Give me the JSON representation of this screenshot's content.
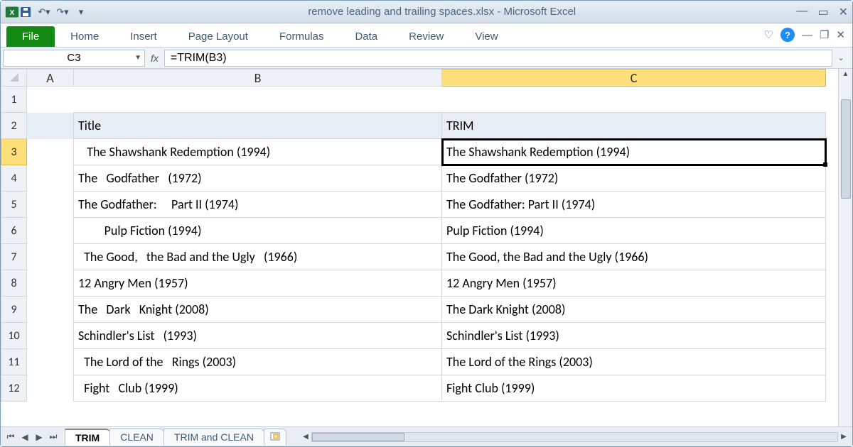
{
  "title": "remove leading and trailing spaces.xlsx  -  Microsoft Excel",
  "ribbon_tabs": [
    "File",
    "Home",
    "Insert",
    "Page Layout",
    "Formulas",
    "Data",
    "Review",
    "View"
  ],
  "namebox": "C3",
  "formula": "=TRIM(B3)",
  "columns": [
    "A",
    "B",
    "C"
  ],
  "headerB": "Title",
  "headerC": "TRIM",
  "rows": [
    {
      "n": 1,
      "b": "",
      "c": ""
    },
    {
      "n": 2,
      "b": "Title",
      "c": "TRIM",
      "hdr": true
    },
    {
      "n": 3,
      "b": "   The Shawshank Redemption (1994)",
      "c": "The Shawshank Redemption (1994)",
      "sel": true
    },
    {
      "n": 4,
      "b": "The   Godfather   (1972)",
      "c": "The Godfather (1972)"
    },
    {
      "n": 5,
      "b": "The Godfather:     Part II (1974)",
      "c": "The Godfather: Part II (1974)"
    },
    {
      "n": 6,
      "b": "         Pulp Fiction (1994)",
      "c": "Pulp Fiction (1994)"
    },
    {
      "n": 7,
      "b": "  The Good,   the Bad and the Ugly   (1966)",
      "c": "The Good, the Bad and the Ugly (1966)"
    },
    {
      "n": 8,
      "b": "12 Angry Men (1957)",
      "c": "12 Angry Men (1957)"
    },
    {
      "n": 9,
      "b": "The   Dark   Knight (2008)",
      "c": "The Dark Knight (2008)"
    },
    {
      "n": 10,
      "b": "Schindler's List   (1993)",
      "c": "Schindler's List (1993)"
    },
    {
      "n": 11,
      "b": "  The Lord of the   Rings (2003)",
      "c": "The Lord of the Rings (2003)"
    },
    {
      "n": 12,
      "b": "  Fight   Club (1999)",
      "c": "Fight Club (1999)"
    }
  ],
  "sheet_tabs": [
    "TRIM",
    "CLEAN",
    "TRIM and CLEAN"
  ],
  "active_sheet": "TRIM",
  "selected_row": 3,
  "selected_col": "C"
}
